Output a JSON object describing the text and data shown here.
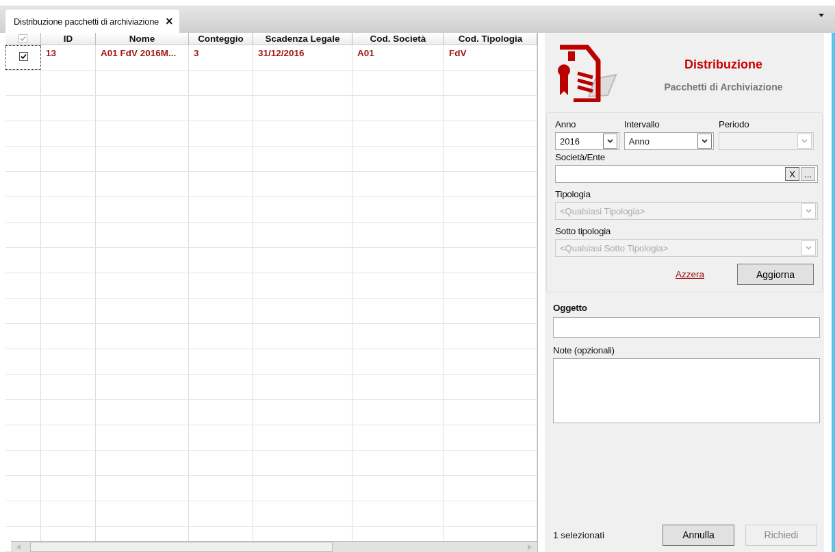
{
  "tabs": [
    {
      "label": "Distribuzione pacchetti di archiviazione",
      "selected": true,
      "close": "×"
    }
  ],
  "table": {
    "header_checkbox": {
      "checked": true,
      "disabled": true
    },
    "columns": [
      "ID",
      "Nome",
      "Conteggio",
      "Scadenza Legale",
      "Cod. Società",
      "Cod. Tipologia"
    ],
    "rows": [
      {
        "checked": true,
        "cells": [
          "13",
          "A01 FdV 2016M...",
          "3",
          "31/12/2016",
          "A01",
          "FdV"
        ]
      }
    ]
  },
  "panel": {
    "title": "Distribuzione",
    "subtitle": "Pacchetti di Archiviazione",
    "filters": [
      {
        "label": "Anno",
        "value": "2016",
        "disabled": false
      },
      {
        "label": "Intervallo",
        "value": "Anno",
        "disabled": false
      },
      {
        "label": "Periodo",
        "disabled": true
      }
    ],
    "company": {
      "label": "Società/Ente",
      "clear": "X",
      "browse": "..."
    },
    "tipologia": {
      "label": "Tipologia",
      "value": "<Qualsiasi Tipologia>",
      "disabled": true
    },
    "sottotipologia": {
      "label": "Sotto tipologia",
      "value": "<Qualsiasi Sotto Tipologia>",
      "disabled": true
    },
    "reset_link": "Azzera",
    "refresh_button": "Aggiorna",
    "subject_label": "Oggetto",
    "notes_label": "Note (opzionali)",
    "selection_count": "1 selezionati",
    "buttons": [
      {
        "label": "Annulla",
        "disabled": false
      },
      {
        "label": "Richiedi",
        "disabled": true
      }
    ]
  }
}
